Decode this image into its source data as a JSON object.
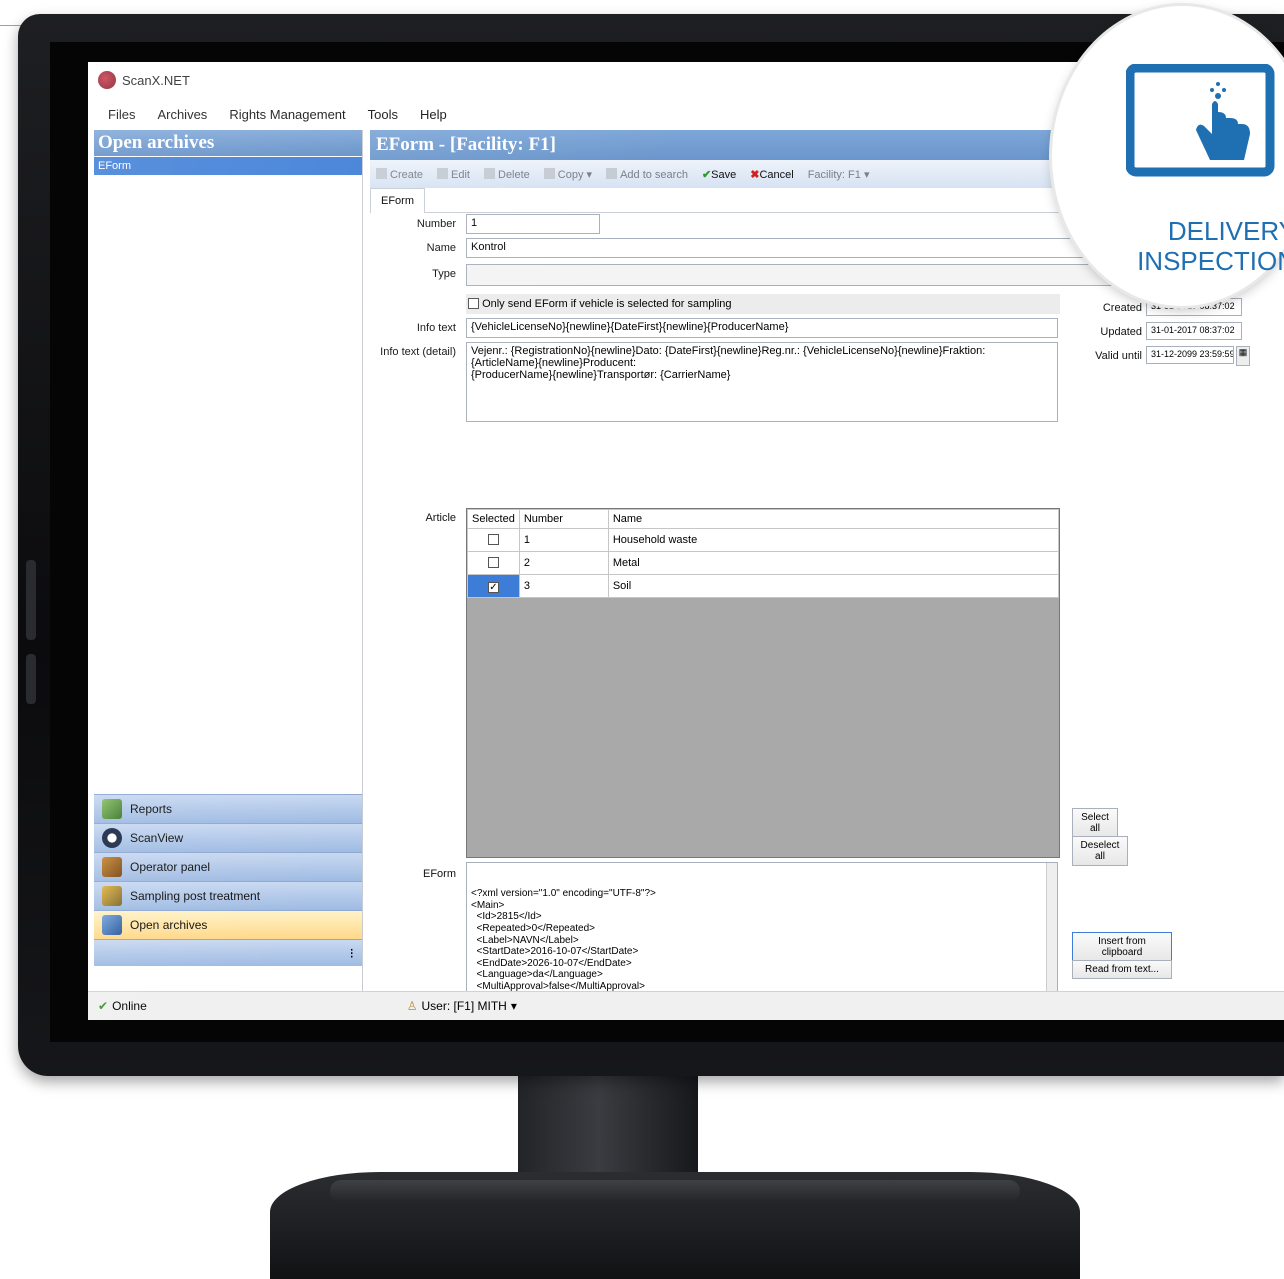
{
  "app": {
    "title": "ScanX.NET"
  },
  "menu": [
    "Files",
    "Archives",
    "Rights Management",
    "Tools",
    "Help"
  ],
  "left_pane": {
    "header": "Open archives",
    "tree": [
      {
        "label": "EForm",
        "selected": true
      }
    ],
    "nav": [
      {
        "label": "Reports",
        "icon": "report-icon",
        "active": false
      },
      {
        "label": "ScanView",
        "icon": "scanview-icon",
        "active": false
      },
      {
        "label": "Operator panel",
        "icon": "operator-icon",
        "active": false
      },
      {
        "label": "Sampling post treatment",
        "icon": "sampling-icon",
        "active": false
      },
      {
        "label": "Open archives",
        "icon": "archive-icon",
        "active": true
      }
    ]
  },
  "main": {
    "header": "EForm - [Facility: F1]",
    "toolbar": {
      "create": "Create",
      "edit": "Edit",
      "delete": "Delete",
      "copy": "Copy",
      "add_to_search": "Add to search",
      "save": "Save",
      "cancel": "Cancel",
      "facility": "Facility: F1"
    },
    "tab": "EForm",
    "form": {
      "number_label": "Number",
      "number_value": "1",
      "name_label": "Name",
      "name_value": "Kontrol",
      "type_label": "Type",
      "type_value": "",
      "checkbox_label": "Only send EForm if vehicle is selected for sampling",
      "info_text_label": "Info text",
      "info_text_value": "{VehicleLicenseNo}{newline}{DateFirst}{newline}{ProducerName}",
      "info_detail_label": "Info text (detail)",
      "info_detail_value_1": "Vejenr.: {RegistrationNo}{newline}Dato: {DateFirst}{newline}Reg.nr.: {VehicleLicenseNo}{newline}Fraktion: {ArticleName}{newline}Producent:",
      "info_detail_value_2": "{ProducerName}{newline}Transportør: {CarrierName}",
      "created_label": "Created",
      "created_value": "31-01-2017 08:37:02",
      "updated_label": "Updated",
      "updated_value": "31-01-2017 08:37:02",
      "valid_until_label": "Valid until",
      "valid_until_value": "31-12-2099 23:59:59",
      "article_label": "Article",
      "article_columns": [
        "Selected",
        "Number",
        "Name"
      ],
      "articles": [
        {
          "selected": false,
          "number": "1",
          "name": "Household waste"
        },
        {
          "selected": false,
          "number": "2",
          "name": "Metal"
        },
        {
          "selected": true,
          "number": "3",
          "name": "Soil"
        }
      ],
      "select_all": "Select all",
      "deselect_all": "Deselect all",
      "eform_label": "EForm",
      "eform_xml": "<?xml version=\"1.0\" encoding=\"UTF-8\"?>\n<Main>\n  <Id>2815</Id>\n  <Repeated>0</Repeated>\n  <Label>NAVN</Label>\n  <StartDate>2016-10-07</StartDate>\n  <EndDate>2026-10-07</EndDate>\n  <Language>da</Language>\n  <MultiApproval>false</MultiApproval>",
      "insert_clipboard": "Insert from clipboard",
      "read_from_text": "Read from text..."
    },
    "pager": [
      "|◄",
      "◄",
      "►",
      "►|"
    ]
  },
  "status": {
    "online": "Online",
    "user": "User: [F1] MITH"
  },
  "badge": {
    "line1": "DELIVERY",
    "line2": "INSPECTION",
    "color": "#1f6fb3"
  }
}
